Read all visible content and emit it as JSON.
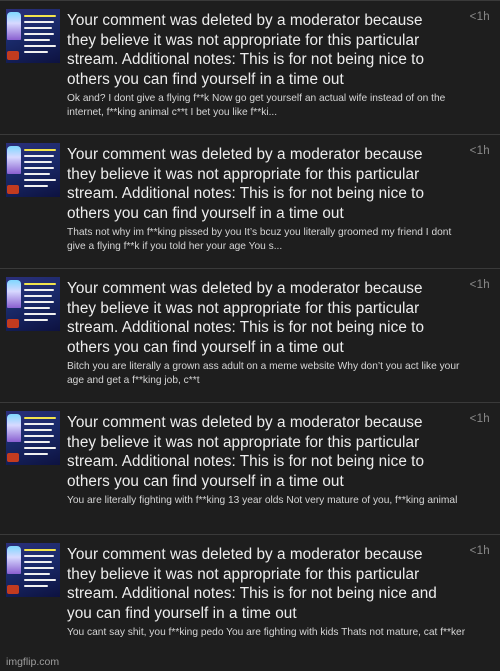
{
  "notifications": [
    {
      "message": "Your comment was deleted by a moderator because they believe it was not appropriate for this particular stream. Additional notes: This is for not being nice to others you can find yourself in a time out",
      "time": "<1h",
      "quote": "Ok and? I dont give a flying f**k Now go get yourself an actual wife instead of on the internet, f**king animal c**t I bet you like f**ki..."
    },
    {
      "message": "Your comment was deleted by a moderator because they believe it was not appropriate for this particular stream. Additional notes: This is for not being nice to others you can find yourself in a time out",
      "time": "<1h",
      "quote": "Thats not why im f**king pissed by you It’s bcuz you literally groomed my friend I dont give a flying f**k if you told her your age You s..."
    },
    {
      "message": "Your comment was deleted by a moderator because they believe it was not appropriate for this particular stream. Additional notes: This is for not being nice to others you can find yourself in a time out",
      "time": "<1h",
      "quote": "Bitch you are literally a grown ass adult on a meme website Why don’t you act like your age and get a f**king job, c**t"
    },
    {
      "message": "Your comment was deleted by a moderator because they believe it was not appropriate for this particular stream. Additional notes: This is for not being nice to others you can find yourself in a time out",
      "time": "<1h",
      "quote": "You are literally fighting with f**king 13 year olds Not very mature of you, f**king animal"
    },
    {
      "message": "Your comment was deleted by a moderator because they believe it was not appropriate for this particular stream. Additional notes: This is for not being nice and you can find yourself in a time out",
      "time": "<1h",
      "quote": "You cant say shit, you f**king pedo You are fighting with kids Thats not mature, cat f**ker"
    }
  ],
  "watermark": "imgflip.com",
  "colors": {
    "background": "#161616",
    "card": "#1e1e1e",
    "message_text": "#ededed",
    "timestamp": "#8a8a8a"
  }
}
